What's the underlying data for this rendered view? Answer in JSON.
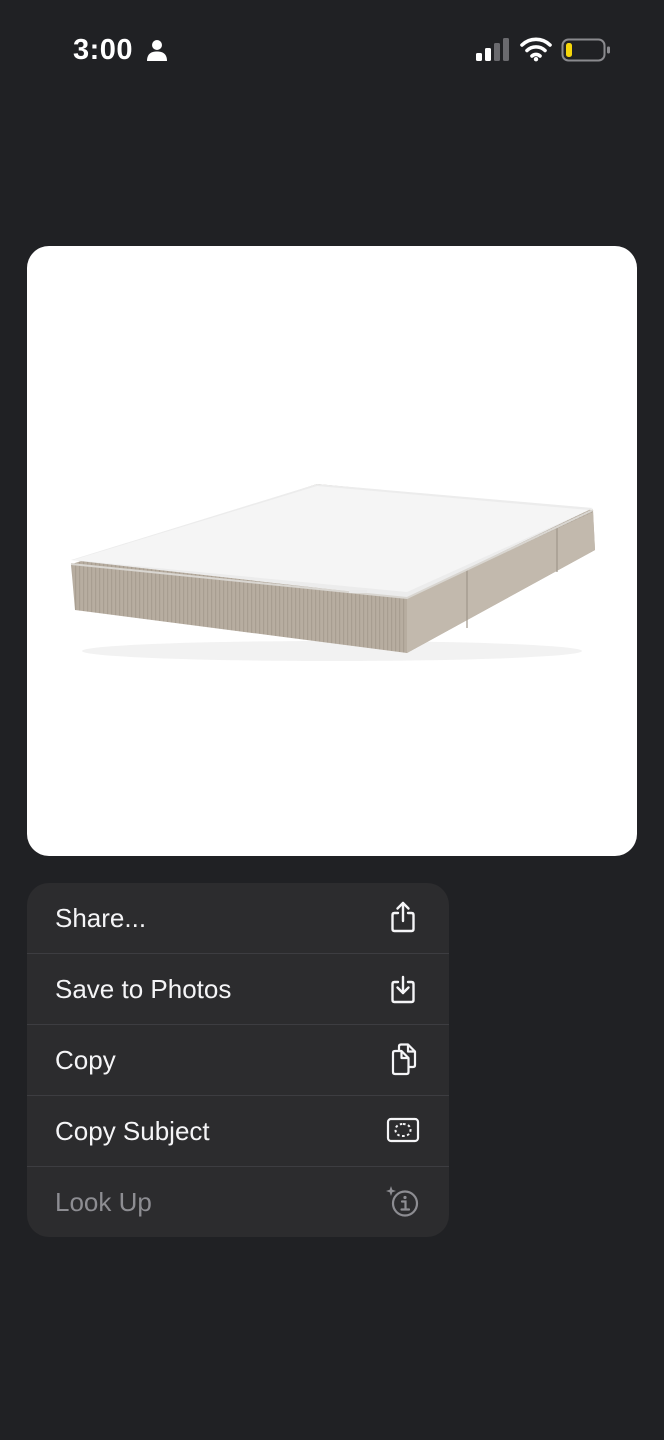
{
  "status_bar": {
    "time": "3:00",
    "icons": [
      "person-icon",
      "cellular-signal-icon",
      "wifi-icon",
      "battery-icon"
    ],
    "battery_color": "#f5d60a"
  },
  "preview": {
    "subject": "mattress"
  },
  "menu": {
    "items": [
      {
        "label": "Share...",
        "icon": "share-icon",
        "enabled": true
      },
      {
        "label": "Save to Photos",
        "icon": "save-to-photos-icon",
        "enabled": true
      },
      {
        "label": "Copy",
        "icon": "copy-icon",
        "enabled": true
      },
      {
        "label": "Copy Subject",
        "icon": "copy-subject-icon",
        "enabled": true
      },
      {
        "label": "Look Up",
        "icon": "look-up-icon",
        "enabled": false
      }
    ]
  },
  "colors": {
    "background": "#202124",
    "menu_background": "#2c2c2e",
    "menu_text": "#f5f5f7",
    "disabled_text": "#8d8d92"
  }
}
